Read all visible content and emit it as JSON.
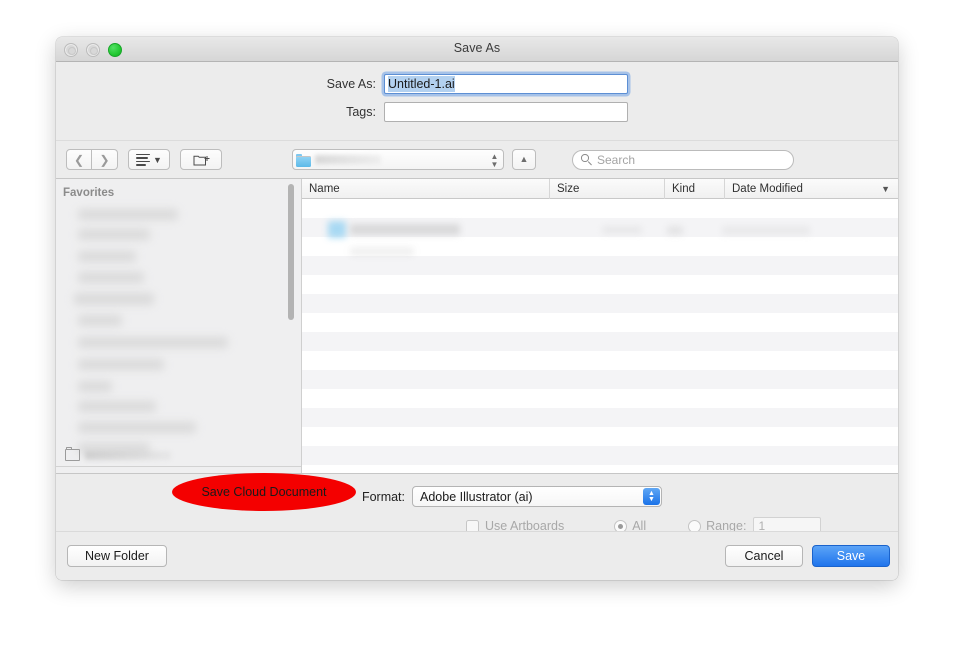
{
  "window": {
    "title": "Save As",
    "traffic_lights": [
      {
        "name": "close",
        "state": "disabled"
      },
      {
        "name": "minimize",
        "state": "disabled"
      },
      {
        "name": "zoom",
        "state": "active",
        "color": "#23c932"
      }
    ]
  },
  "name_panel": {
    "save_as_label": "Save As:",
    "save_as_value": "Untitled-1.ai",
    "tags_label": "Tags:",
    "tags_value": "",
    "tags_placeholder": ""
  },
  "toolbar": {
    "back_icon": "chevron-left",
    "forward_icon": "chevron-right",
    "view_icon": "list-view",
    "view_caret_icon": "chevron-down",
    "new_folder_icon": "new-folder",
    "path_folder_name": "",
    "path_stepper_icon": "up-down-arrows",
    "up_button_icon": "chevron-up",
    "search_placeholder": "Search",
    "search_value": "",
    "search_icon": "magnifier"
  },
  "sidebar": {
    "header": "Favorites",
    "items": [
      "",
      "",
      "",
      "",
      "",
      "",
      "",
      "",
      "",
      "",
      "",
      ""
    ],
    "last_item": ""
  },
  "filelist": {
    "columns": [
      "Name",
      "Size",
      "Kind",
      "Date Modified"
    ],
    "sort_indicator_icon": "chevron-down",
    "rows": []
  },
  "options": {
    "format_label": "Format:",
    "format_value": "Adobe Illustrator (ai)",
    "format_stepper_icon": "up-down-arrows",
    "use_artboards_label": "Use Artboards",
    "use_artboards_checked": false,
    "all_label": "All",
    "all_selected": true,
    "range_label": "Range:",
    "range_selected": false,
    "range_value": "1",
    "disabled": true
  },
  "footer": {
    "new_folder_label": "New Folder",
    "cancel_label": "Cancel",
    "save_label": "Save",
    "save_accent_color": "#1f74ec"
  },
  "annotation": {
    "text": "Save Cloud Document",
    "shape": "ellipse",
    "color": "#f40000"
  }
}
